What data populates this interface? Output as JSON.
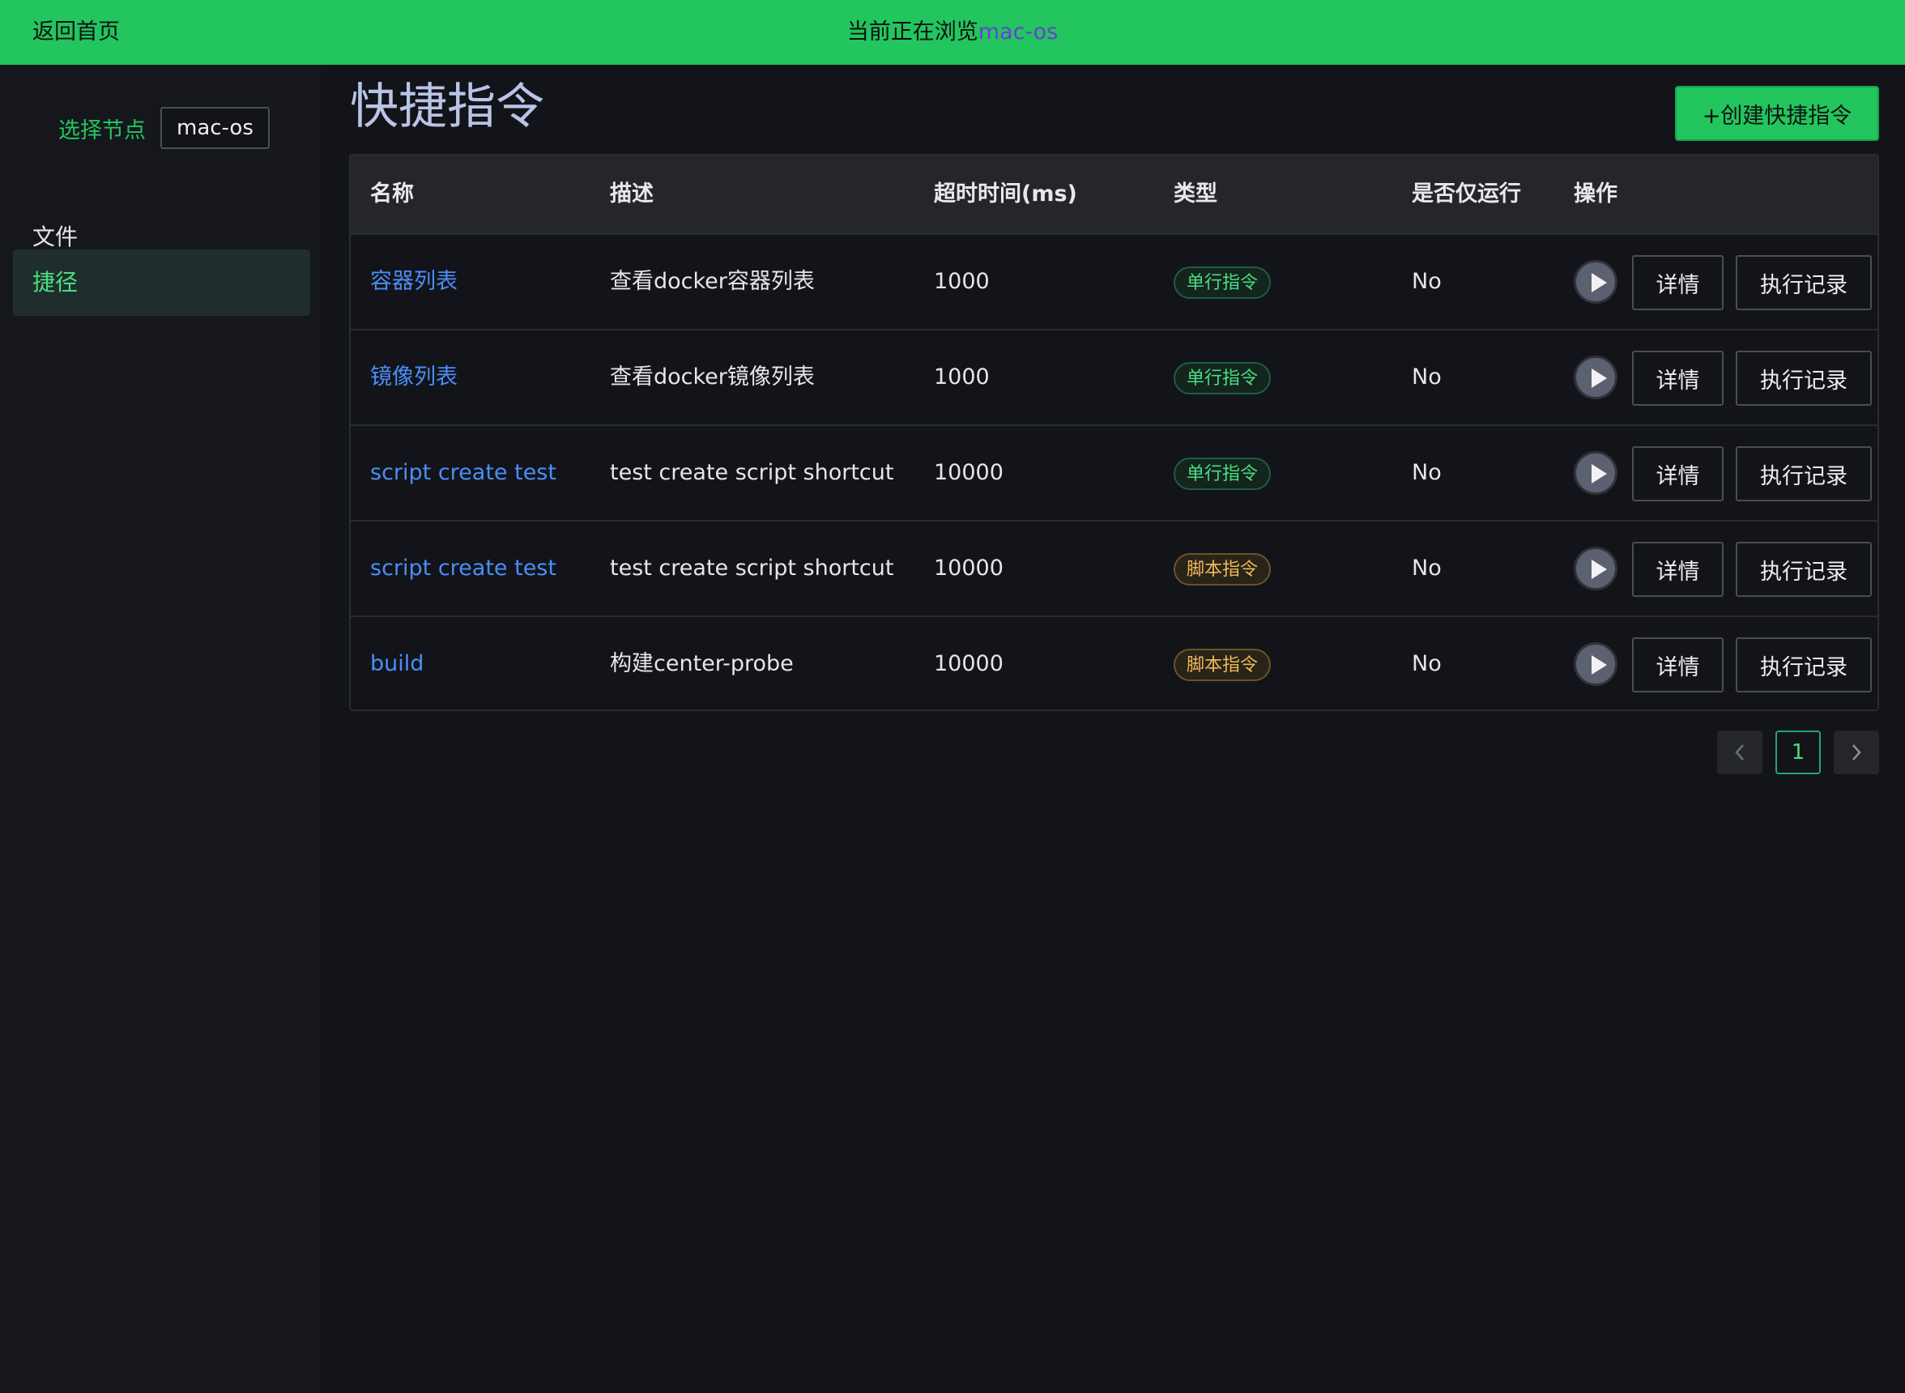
{
  "topbar": {
    "home_label": "返回首页",
    "browsing_prefix": "当前正在浏览",
    "browsing_node": "mac-os"
  },
  "sidebar": {
    "node_label": "选择节点",
    "node_value": "mac-os",
    "items": [
      {
        "label": "文件"
      },
      {
        "label": "捷径"
      }
    ]
  },
  "main": {
    "title": "快捷指令",
    "create_button": "+创建快捷指令",
    "table": {
      "headers": [
        "名称",
        "描述",
        "超时时间(ms)",
        "类型",
        "是否仅运行",
        "操作"
      ],
      "rows": [
        {
          "name": "容器列表",
          "description": "查看docker容器列表",
          "timeout": "1000",
          "type": "单行指令",
          "only_run": "No",
          "detail": "详情",
          "log": "执行记录"
        },
        {
          "name": "镜像列表",
          "description": "查看docker镜像列表",
          "timeout": "1000",
          "type": "单行指令",
          "only_run": "No",
          "detail": "详情",
          "log": "执行记录"
        },
        {
          "name": "script create test",
          "description": "test create script shortcut",
          "timeout": "10000",
          "type": "单行指令",
          "only_run": "No",
          "detail": "详情",
          "log": "执行记录"
        },
        {
          "name": "script create test",
          "description": "test create script shortcut",
          "timeout": "10000",
          "type": "脚本指令",
          "only_run": "No",
          "detail": "详情",
          "log": "执行记录"
        },
        {
          "name": "build",
          "description": "构建center-probe",
          "timeout": "10000",
          "type": "脚本指令",
          "only_run": "No",
          "detail": "详情",
          "log": "执行记录"
        }
      ]
    },
    "pagination": {
      "current_page": "1"
    }
  },
  "colors": {
    "topbar_bg": "#22c55e",
    "accent_green": "#22c55e",
    "link_blue": "#4b8df8",
    "node_purple": "#6b3fd6",
    "tag_single": "#4ade80",
    "tag_script": "#f0b85a"
  }
}
